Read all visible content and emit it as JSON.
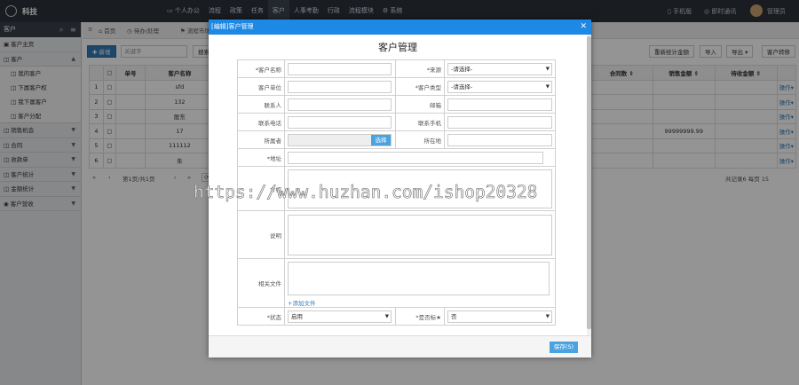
{
  "app": {
    "brand": "科技"
  },
  "topnav": [
    "个人办公",
    "流程",
    "政策",
    "任务",
    "客户",
    "人事考勤",
    "行政",
    "流程模块",
    "系统"
  ],
  "topnav_active": 4,
  "topright": {
    "mobile": "手机版",
    "im": "即时通讯",
    "user": "管理员"
  },
  "sidebar": {
    "title": "客户",
    "items": [
      {
        "label": "客户主页",
        "type": "item"
      },
      {
        "label": "客户",
        "type": "group"
      },
      {
        "label": "我的客户",
        "type": "sub"
      },
      {
        "label": "下属客户权",
        "type": "sub"
      },
      {
        "label": "我下属客户",
        "type": "sub"
      },
      {
        "label": "客户分配",
        "type": "sub"
      },
      {
        "label": "销售机会",
        "type": "group"
      },
      {
        "label": "合同",
        "type": "group"
      },
      {
        "label": "收款单",
        "type": "group"
      },
      {
        "label": "客户统计",
        "type": "group"
      },
      {
        "label": "金额统计",
        "type": "group"
      },
      {
        "label": "客户营收",
        "type": "group"
      }
    ]
  },
  "tabs": [
    "首页",
    "待办/处理",
    "流程市场"
  ],
  "toolbar": {
    "add": "新增",
    "keyword_placeholder": "关键字",
    "search": "搜索",
    "recalc": "重新统计金额",
    "import": "导入",
    "export": "导出",
    "transfer": "客户转移"
  },
  "grid": {
    "headers": [
      "",
      "",
      "单号",
      "客户名称",
      "合同数",
      "销售金额",
      "待收金额",
      ""
    ],
    "rows": [
      {
        "no": "1",
        "name": "sfd",
        "amount": "",
        "op": "操作"
      },
      {
        "no": "2",
        "name": "132",
        "amount": "",
        "op": "操作"
      },
      {
        "no": "3",
        "name": "股东",
        "amount": "",
        "op": "操作"
      },
      {
        "no": "4",
        "name": "17",
        "amount": "99999999.99",
        "op": "操作"
      },
      {
        "no": "5",
        "name": "111112",
        "amount": "",
        "op": "操作"
      },
      {
        "no": "6",
        "name": "朱",
        "amount": "",
        "op": "操作"
      }
    ]
  },
  "pager": {
    "page": "第1页/共1页",
    "records": "共记录6 每页 15"
  },
  "modal": {
    "title": "[编辑]客户管理",
    "form_title": "客户管理",
    "fields": {
      "name_label": "*客户名称",
      "source_label": "*来源",
      "source_value": "-请选择-",
      "unit_label": "客户单位",
      "type_label": "*客户类型",
      "type_value": "-请选择-",
      "contact_label": "联系人",
      "email_label": "邮箱",
      "phone_label": "联系电话",
      "mobile_label": "联系手机",
      "owner_label": "所属者",
      "pick": "选择",
      "city_label": "所在地",
      "address_label": "*地址",
      "intro_label": "介绍",
      "remark_label": "说明",
      "files_label": "相关文件",
      "add_file": "+添加文件",
      "status_label": "*状态",
      "status_value": "启用",
      "vip_label": "*是否标★",
      "vip_value": "否"
    },
    "save": "保存(S)"
  },
  "watermark": "https://www.huzhan.com/ishop20328"
}
